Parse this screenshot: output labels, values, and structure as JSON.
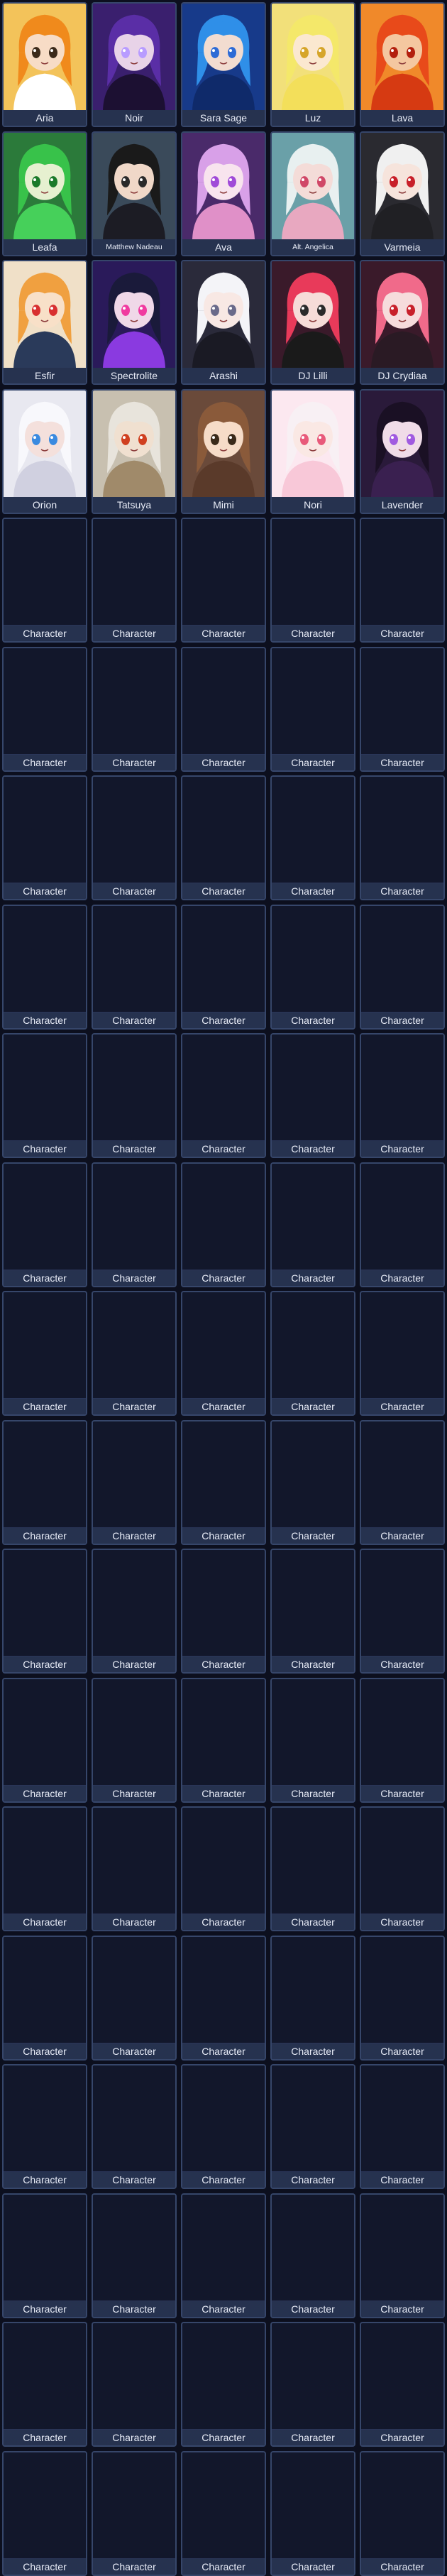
{
  "default_label": "Character",
  "characters": [
    {
      "name": "Aria",
      "bg": "#f3c35a",
      "hair": "#f08a1c",
      "skin": "#f7dcc6",
      "eyes": "#3b2a1a",
      "outfit": "#ffffff"
    },
    {
      "name": "Noir",
      "bg": "#3a1f6e",
      "hair": "#5a2ea6",
      "skin": "#e8d3e8",
      "eyes": "#b89cff",
      "outfit": "#1c1032"
    },
    {
      "name": "Sara Sage",
      "bg": "#173a8a",
      "hair": "#2f8fe8",
      "skin": "#f2dcd0",
      "eyes": "#2d6bd6",
      "outfit": "#0f2a6a"
    },
    {
      "name": "Luz",
      "bg": "#f2e07a",
      "hair": "#f4e86a",
      "skin": "#fbe8d0",
      "eyes": "#d6a52a",
      "outfit": "#f3df5a"
    },
    {
      "name": "Lava",
      "bg": "#f0892a",
      "hair": "#e84a1a",
      "skin": "#f4c7a0",
      "eyes": "#b3200e",
      "outfit": "#d63a12"
    },
    {
      "name": "Leafa",
      "bg": "#2b7a3a",
      "hair": "#38c24a",
      "skin": "#e6f0d0",
      "eyes": "#1a7a2a",
      "outfit": "#46d05a"
    },
    {
      "name": "Matthew Nadeau",
      "bg": "#3a4a5a",
      "hair": "#1a1a1a",
      "skin": "#f0d8c8",
      "eyes": "#2a2a2a",
      "outfit": "#1c1c24"
    },
    {
      "name": "Ava",
      "bg": "#4a2a6a",
      "hair": "#d8a0e8",
      "skin": "#f8e4ee",
      "eyes": "#a04ad8",
      "outfit": "#e090c8"
    },
    {
      "name": "Alt. Angelica",
      "bg": "#6aa0a8",
      "hair": "#e8f0f0",
      "skin": "#f4dcd8",
      "eyes": "#d04868",
      "outfit": "#e8a8c0"
    },
    {
      "name": "Varmeia",
      "bg": "#2a2a30",
      "hair": "#f0f0f0",
      "skin": "#f6e4dc",
      "eyes": "#c8202a",
      "outfit": "#202024"
    },
    {
      "name": "Esfir",
      "bg": "#f0e0c8",
      "hair": "#f0a040",
      "skin": "#f8e0c8",
      "eyes": "#d83030",
      "outfit": "#2a3a5a"
    },
    {
      "name": "Spectrolite",
      "bg": "#2a1a5a",
      "hair": "#1a1a3a",
      "skin": "#f0d8e8",
      "eyes": "#f03aa0",
      "outfit": "#8a3ae0"
    },
    {
      "name": "Arashi",
      "bg": "#2a2a3a",
      "hair": "#f4f4f8",
      "skin": "#f8e8e4",
      "eyes": "#6a6a8a",
      "outfit": "#1a1a24"
    },
    {
      "name": "DJ Lilli",
      "bg": "#3a1a2a",
      "hair": "#e83a5a",
      "skin": "#f6dcd8",
      "eyes": "#2a2a2a",
      "outfit": "#1a1a1a"
    },
    {
      "name": "DJ Crydiaa",
      "bg": "#3a1a2a",
      "hair": "#f06a8a",
      "skin": "#f6dcdc",
      "eyes": "#c8202a",
      "outfit": "#2a1a24"
    },
    {
      "name": "Orion",
      "bg": "#e8e8f0",
      "hair": "#f8f8fc",
      "skin": "#f4e0dc",
      "eyes": "#3a8ae0",
      "outfit": "#d0d0e0"
    },
    {
      "name": "Tatsuya",
      "bg": "#c8c0b0",
      "hair": "#e8e4dc",
      "skin": "#f0e0d0",
      "eyes": "#d04020",
      "outfit": "#a08a6a"
    },
    {
      "name": "Mimi",
      "bg": "#6a4a3a",
      "hair": "#8a5a3a",
      "skin": "#f6dcc8",
      "eyes": "#3a2a1a",
      "outfit": "#5a3a2a"
    },
    {
      "name": "Nori",
      "bg": "#fce8f0",
      "hair": "#f8f0f4",
      "skin": "#fae8e4",
      "eyes": "#e85a7a",
      "outfit": "#f8c8d8"
    },
    {
      "name": "Lavender",
      "bg": "#2a1a3a",
      "hair": "#1a1024",
      "skin": "#f0dce8",
      "eyes": "#a05ae0",
      "outfit": "#3a2050"
    }
  ],
  "empty_slot_count": 80
}
